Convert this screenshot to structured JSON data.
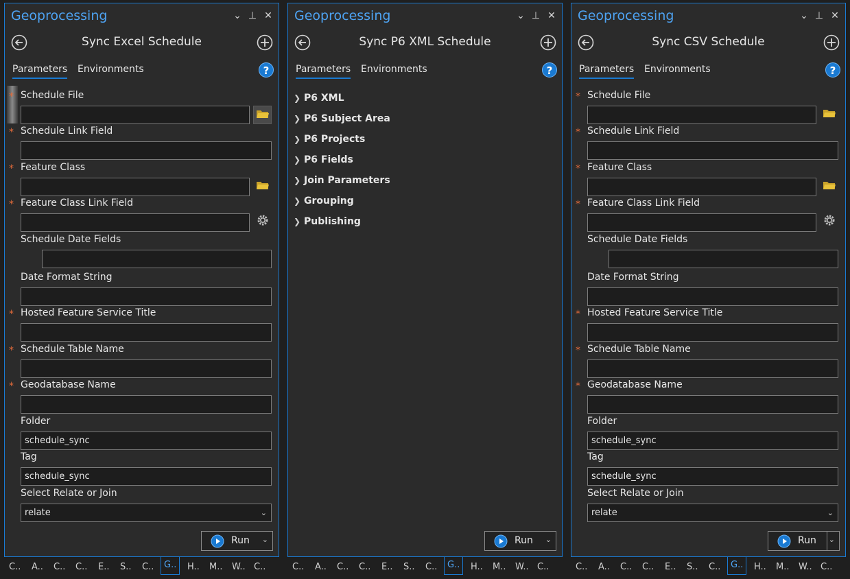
{
  "panes": [
    {
      "title": "Geoprocessing",
      "tool_name": "Sync Excel Schedule",
      "tabs": [
        "Parameters",
        "Environments"
      ],
      "fields": [
        {
          "label": "Schedule File",
          "required": true,
          "value": ""
        },
        {
          "label": "Schedule Link Field",
          "required": true,
          "value": ""
        },
        {
          "label": "Feature Class",
          "required": true,
          "value": ""
        },
        {
          "label": "Feature Class Link Field",
          "required": true,
          "value": ""
        },
        {
          "label": "Schedule Date Fields",
          "required": false,
          "value": ""
        },
        {
          "label": "Date Format String",
          "required": false,
          "value": ""
        },
        {
          "label": "Hosted Feature Service Title",
          "required": true,
          "value": ""
        },
        {
          "label": "Schedule Table Name",
          "required": true,
          "value": ""
        },
        {
          "label": "Geodatabase Name",
          "required": true,
          "value": ""
        },
        {
          "label": "Folder",
          "required": false,
          "value": "schedule_sync"
        },
        {
          "label": "Tag",
          "required": false,
          "value": "schedule_sync"
        },
        {
          "label": "Select Relate or Join",
          "required": false,
          "value": "relate"
        }
      ],
      "run_label": "Run"
    },
    {
      "title": "Geoprocessing",
      "tool_name": "Sync P6 XML Schedule",
      "tabs": [
        "Parameters",
        "Environments"
      ],
      "groups": [
        "P6 XML",
        "P6 Subject Area",
        "P6 Projects",
        "P6 Fields",
        "Join Parameters",
        "Grouping",
        "Publishing"
      ],
      "run_label": "Run"
    },
    {
      "title": "Geoprocessing",
      "tool_name": "Sync CSV Schedule",
      "tabs": [
        "Parameters",
        "Environments"
      ],
      "fields": [
        {
          "label": "Schedule File",
          "required": true,
          "value": ""
        },
        {
          "label": "Schedule Link Field",
          "required": true,
          "value": ""
        },
        {
          "label": "Feature Class",
          "required": true,
          "value": ""
        },
        {
          "label": "Feature Class Link Field",
          "required": true,
          "value": ""
        },
        {
          "label": "Schedule Date Fields",
          "required": false,
          "value": ""
        },
        {
          "label": "Date Format String",
          "required": false,
          "value": ""
        },
        {
          "label": "Hosted Feature Service Title",
          "required": true,
          "value": ""
        },
        {
          "label": "Schedule Table Name",
          "required": true,
          "value": ""
        },
        {
          "label": "Geodatabase Name",
          "required": true,
          "value": ""
        },
        {
          "label": "Folder",
          "required": false,
          "value": "schedule_sync"
        },
        {
          "label": "Tag",
          "required": false,
          "value": "schedule_sync"
        },
        {
          "label": "Select Relate or Join",
          "required": false,
          "value": "relate"
        }
      ],
      "run_label": "Run"
    }
  ],
  "bottom_tabs": [
    "C..",
    "A..",
    "C..",
    "C..",
    "E..",
    "S..",
    "C..",
    "G..",
    "H..",
    "M..",
    "W..",
    "C.."
  ],
  "active_bottom_tab": "G..",
  "required_marker": "*",
  "colors": {
    "accent": "#1a7ad2",
    "title": "#4ea3f2",
    "required": "#e06a3a",
    "folder": "#e8c23a"
  }
}
